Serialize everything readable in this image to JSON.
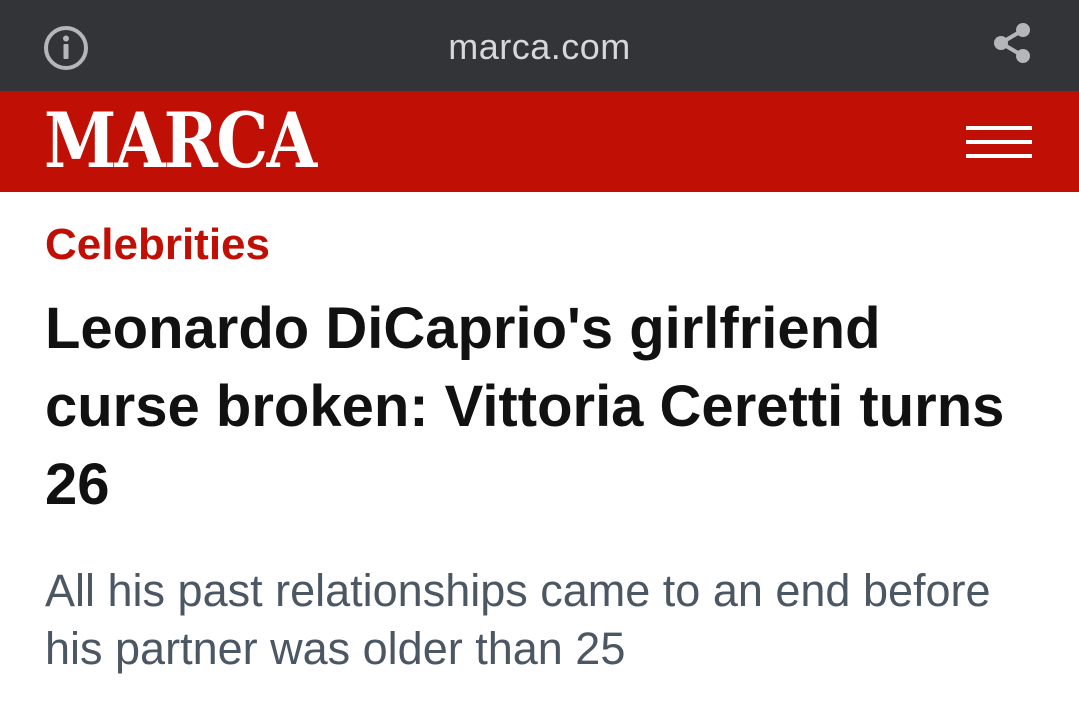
{
  "browser": {
    "url": "marca.com",
    "info_icon": "info-icon",
    "share_icon": "share-icon"
  },
  "header": {
    "logo": "MARCA",
    "menu_icon": "hamburger-menu-icon",
    "color": "#c00f05"
  },
  "article": {
    "category": "Celebrities",
    "headline": "Leonardo DiCaprio's girlfriend curse broken: Vittoria Ceretti turns 26",
    "subtitle": "All his past relationships came to an end before his partner was older than 25"
  },
  "colors": {
    "browser_bar": "#333437",
    "accent": "#c00f05",
    "headline": "#111111",
    "subtitle": "#4b5763"
  }
}
